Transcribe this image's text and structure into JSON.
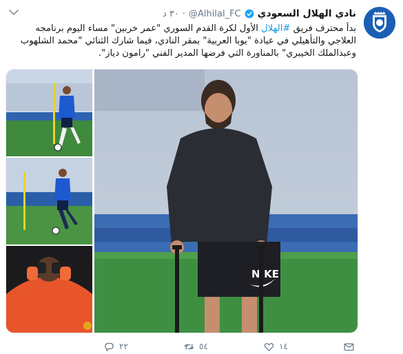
{
  "tweet": {
    "author_name": "نادي الهلال السعودي",
    "handle": "@Alhilal_FC",
    "separator": "·",
    "time": "٣٠ د",
    "text_before": "بدأ محترف  فريق ",
    "hashtag": "#الهلال",
    "text_after": " الأول لكرة القدم السوري \"عمر خربين\" مساء اليوم برنامجه العلاجي والتأهيلي في عيادة \"يوبا العربية\" بمقر النادي، فيما شارك الثنائي \"محمد الشلهوب وعبدالملك الخيبري\" بالمناورة التي فرضها المدير الفني \"رامون دياز\".",
    "photo_text": "NIKE",
    "actions": {
      "reply_count": "٢٢",
      "retweet_count": "٥٤",
      "like_count": "١٤"
    }
  },
  "colors": {
    "link": "#1b95e0",
    "muted": "#657786",
    "verified": "#1da1f2",
    "brand_blue": "#1b5fb4"
  },
  "icons": [
    "avatar-logo",
    "verified-badge-icon",
    "chevron-down-icon",
    "reply-icon",
    "retweet-icon",
    "like-icon",
    "dm-icon"
  ]
}
